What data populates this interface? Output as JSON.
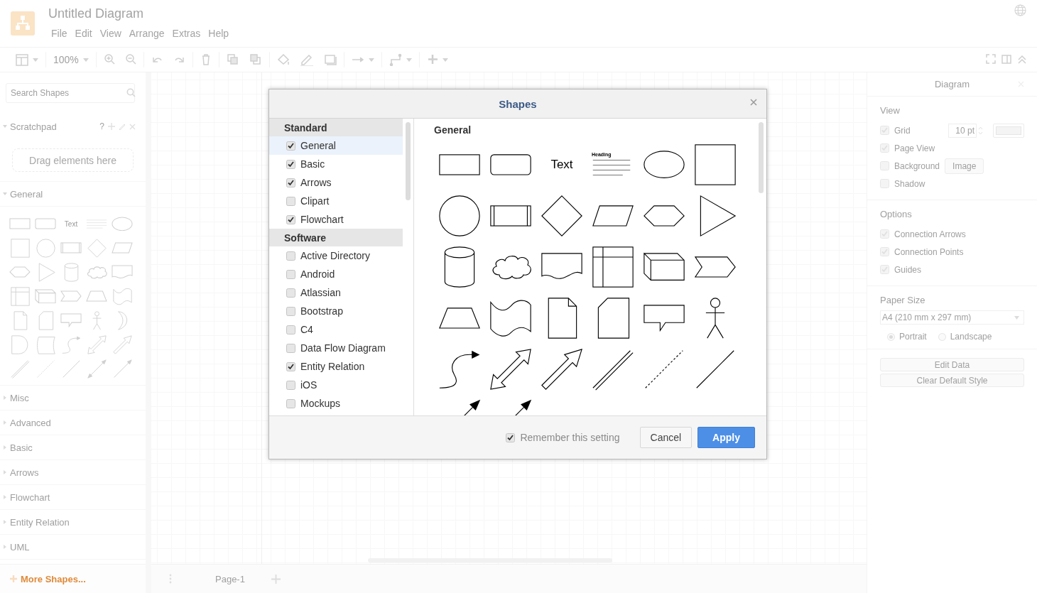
{
  "app": {
    "title": "Untitled Diagram",
    "menu": [
      "File",
      "Edit",
      "View",
      "Arrange",
      "Extras",
      "Help"
    ]
  },
  "toolbar": {
    "zoom": "100%"
  },
  "sidebar": {
    "search_placeholder": "Search Shapes",
    "scratchpad": {
      "title": "Scratchpad",
      "expanded": true,
      "help": "?",
      "drop_hint": "Drag elements here"
    },
    "sections": [
      {
        "title": "General",
        "expanded": true,
        "text_tile": "Text"
      },
      {
        "title": "Misc",
        "expanded": false
      },
      {
        "title": "Advanced",
        "expanded": false
      },
      {
        "title": "Basic",
        "expanded": false
      },
      {
        "title": "Arrows",
        "expanded": false
      },
      {
        "title": "Flowchart",
        "expanded": false
      },
      {
        "title": "Entity Relation",
        "expanded": false
      },
      {
        "title": "UML",
        "expanded": false
      }
    ],
    "more_shapes": "More Shapes..."
  },
  "pages": [
    {
      "label": "Page-1"
    }
  ],
  "format_panel": {
    "title": "Diagram",
    "view": {
      "title": "View",
      "grid": {
        "label": "Grid",
        "checked": true,
        "size": "10 pt"
      },
      "page_view": {
        "label": "Page View",
        "checked": true
      },
      "background": {
        "label": "Background",
        "checked": false,
        "button": "Image"
      },
      "shadow": {
        "label": "Shadow",
        "checked": false
      }
    },
    "options": {
      "title": "Options",
      "items": [
        {
          "label": "Connection Arrows",
          "checked": true
        },
        {
          "label": "Connection Points",
          "checked": true
        },
        {
          "label": "Guides",
          "checked": true
        }
      ]
    },
    "paper": {
      "title": "Paper Size",
      "size": "A4 (210 mm x 297 mm)",
      "orientations": [
        {
          "label": "Portrait",
          "selected": true
        },
        {
          "label": "Landscape",
          "selected": false
        }
      ]
    },
    "buttons": [
      "Edit Data",
      "Clear Default Style"
    ]
  },
  "dialog": {
    "title": "Shapes",
    "groups": [
      {
        "title": "Standard",
        "items": [
          {
            "label": "General",
            "checked": true,
            "selected": true
          },
          {
            "label": "Basic",
            "checked": true,
            "selected": false
          },
          {
            "label": "Arrows",
            "checked": true,
            "selected": false
          },
          {
            "label": "Clipart",
            "checked": false,
            "selected": false
          },
          {
            "label": "Flowchart",
            "checked": true,
            "selected": false
          }
        ]
      },
      {
        "title": "Software",
        "items": [
          {
            "label": "Active Directory",
            "checked": false,
            "selected": false
          },
          {
            "label": "Android",
            "checked": false,
            "selected": false
          },
          {
            "label": "Atlassian",
            "checked": false,
            "selected": false
          },
          {
            "label": "Bootstrap",
            "checked": false,
            "selected": false
          },
          {
            "label": "C4",
            "checked": false,
            "selected": false
          },
          {
            "label": "Data Flow Diagram",
            "checked": false,
            "selected": false
          },
          {
            "label": "Entity Relation",
            "checked": true,
            "selected": false
          },
          {
            "label": "iOS",
            "checked": false,
            "selected": false
          },
          {
            "label": "Mockups",
            "checked": false,
            "selected": false
          }
        ]
      }
    ],
    "preview": {
      "title": "General",
      "text_tile": "Text",
      "heading_tile": "Heading"
    },
    "remember": {
      "label": "Remember this setting",
      "checked": true
    },
    "buttons": [
      {
        "label": "Cancel",
        "kind": "secondary"
      },
      {
        "label": "Apply",
        "kind": "primary"
      }
    ]
  }
}
